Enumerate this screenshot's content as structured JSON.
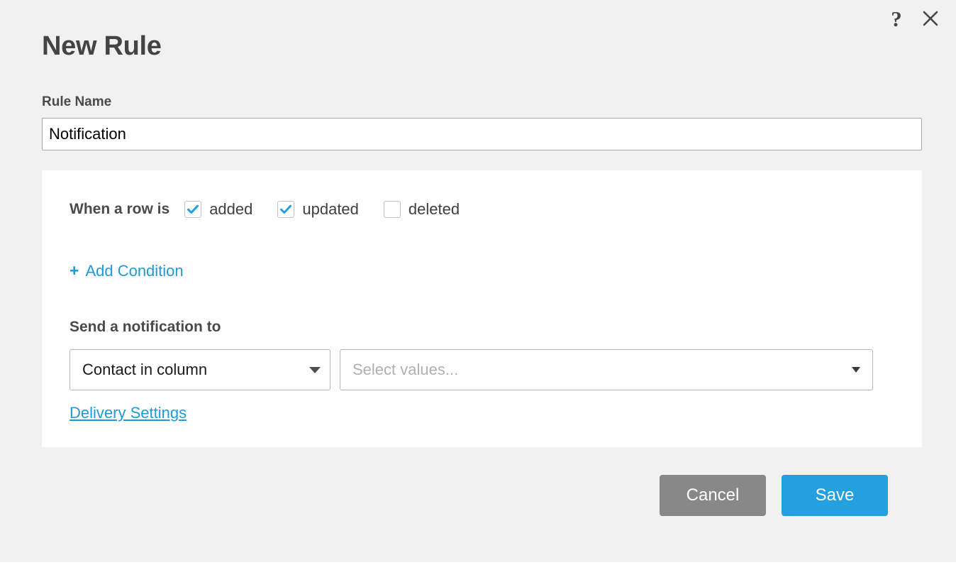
{
  "window": {
    "help_icon": "question-mark-icon",
    "close_icon": "close-icon"
  },
  "dialog": {
    "title": "New Rule"
  },
  "rule_name": {
    "label": "Rule Name",
    "value": "Notification",
    "placeholder": "Rule Name"
  },
  "trigger": {
    "label": "When a row is",
    "options": [
      {
        "label": "added",
        "checked": true
      },
      {
        "label": "updated",
        "checked": true
      },
      {
        "label": "deleted",
        "checked": false
      }
    ]
  },
  "add_condition": {
    "plus": "+",
    "label": "Add Condition"
  },
  "notification": {
    "heading": "Send a notification to",
    "recipient_select": {
      "value": "Contact in column",
      "caret_icon": "chevron-down-icon"
    },
    "values_select": {
      "placeholder": "Select values...",
      "caret_icon": "chevron-down-icon"
    },
    "delivery_settings_label": "Delivery Settings"
  },
  "footer": {
    "cancel_label": "Cancel",
    "save_label": "Save"
  },
  "colors": {
    "accent": "#23a0dd",
    "link": "#1f9ad6",
    "cancel": "#888888",
    "background": "#f1f1f1",
    "card": "#ffffff",
    "text": "#444444"
  }
}
